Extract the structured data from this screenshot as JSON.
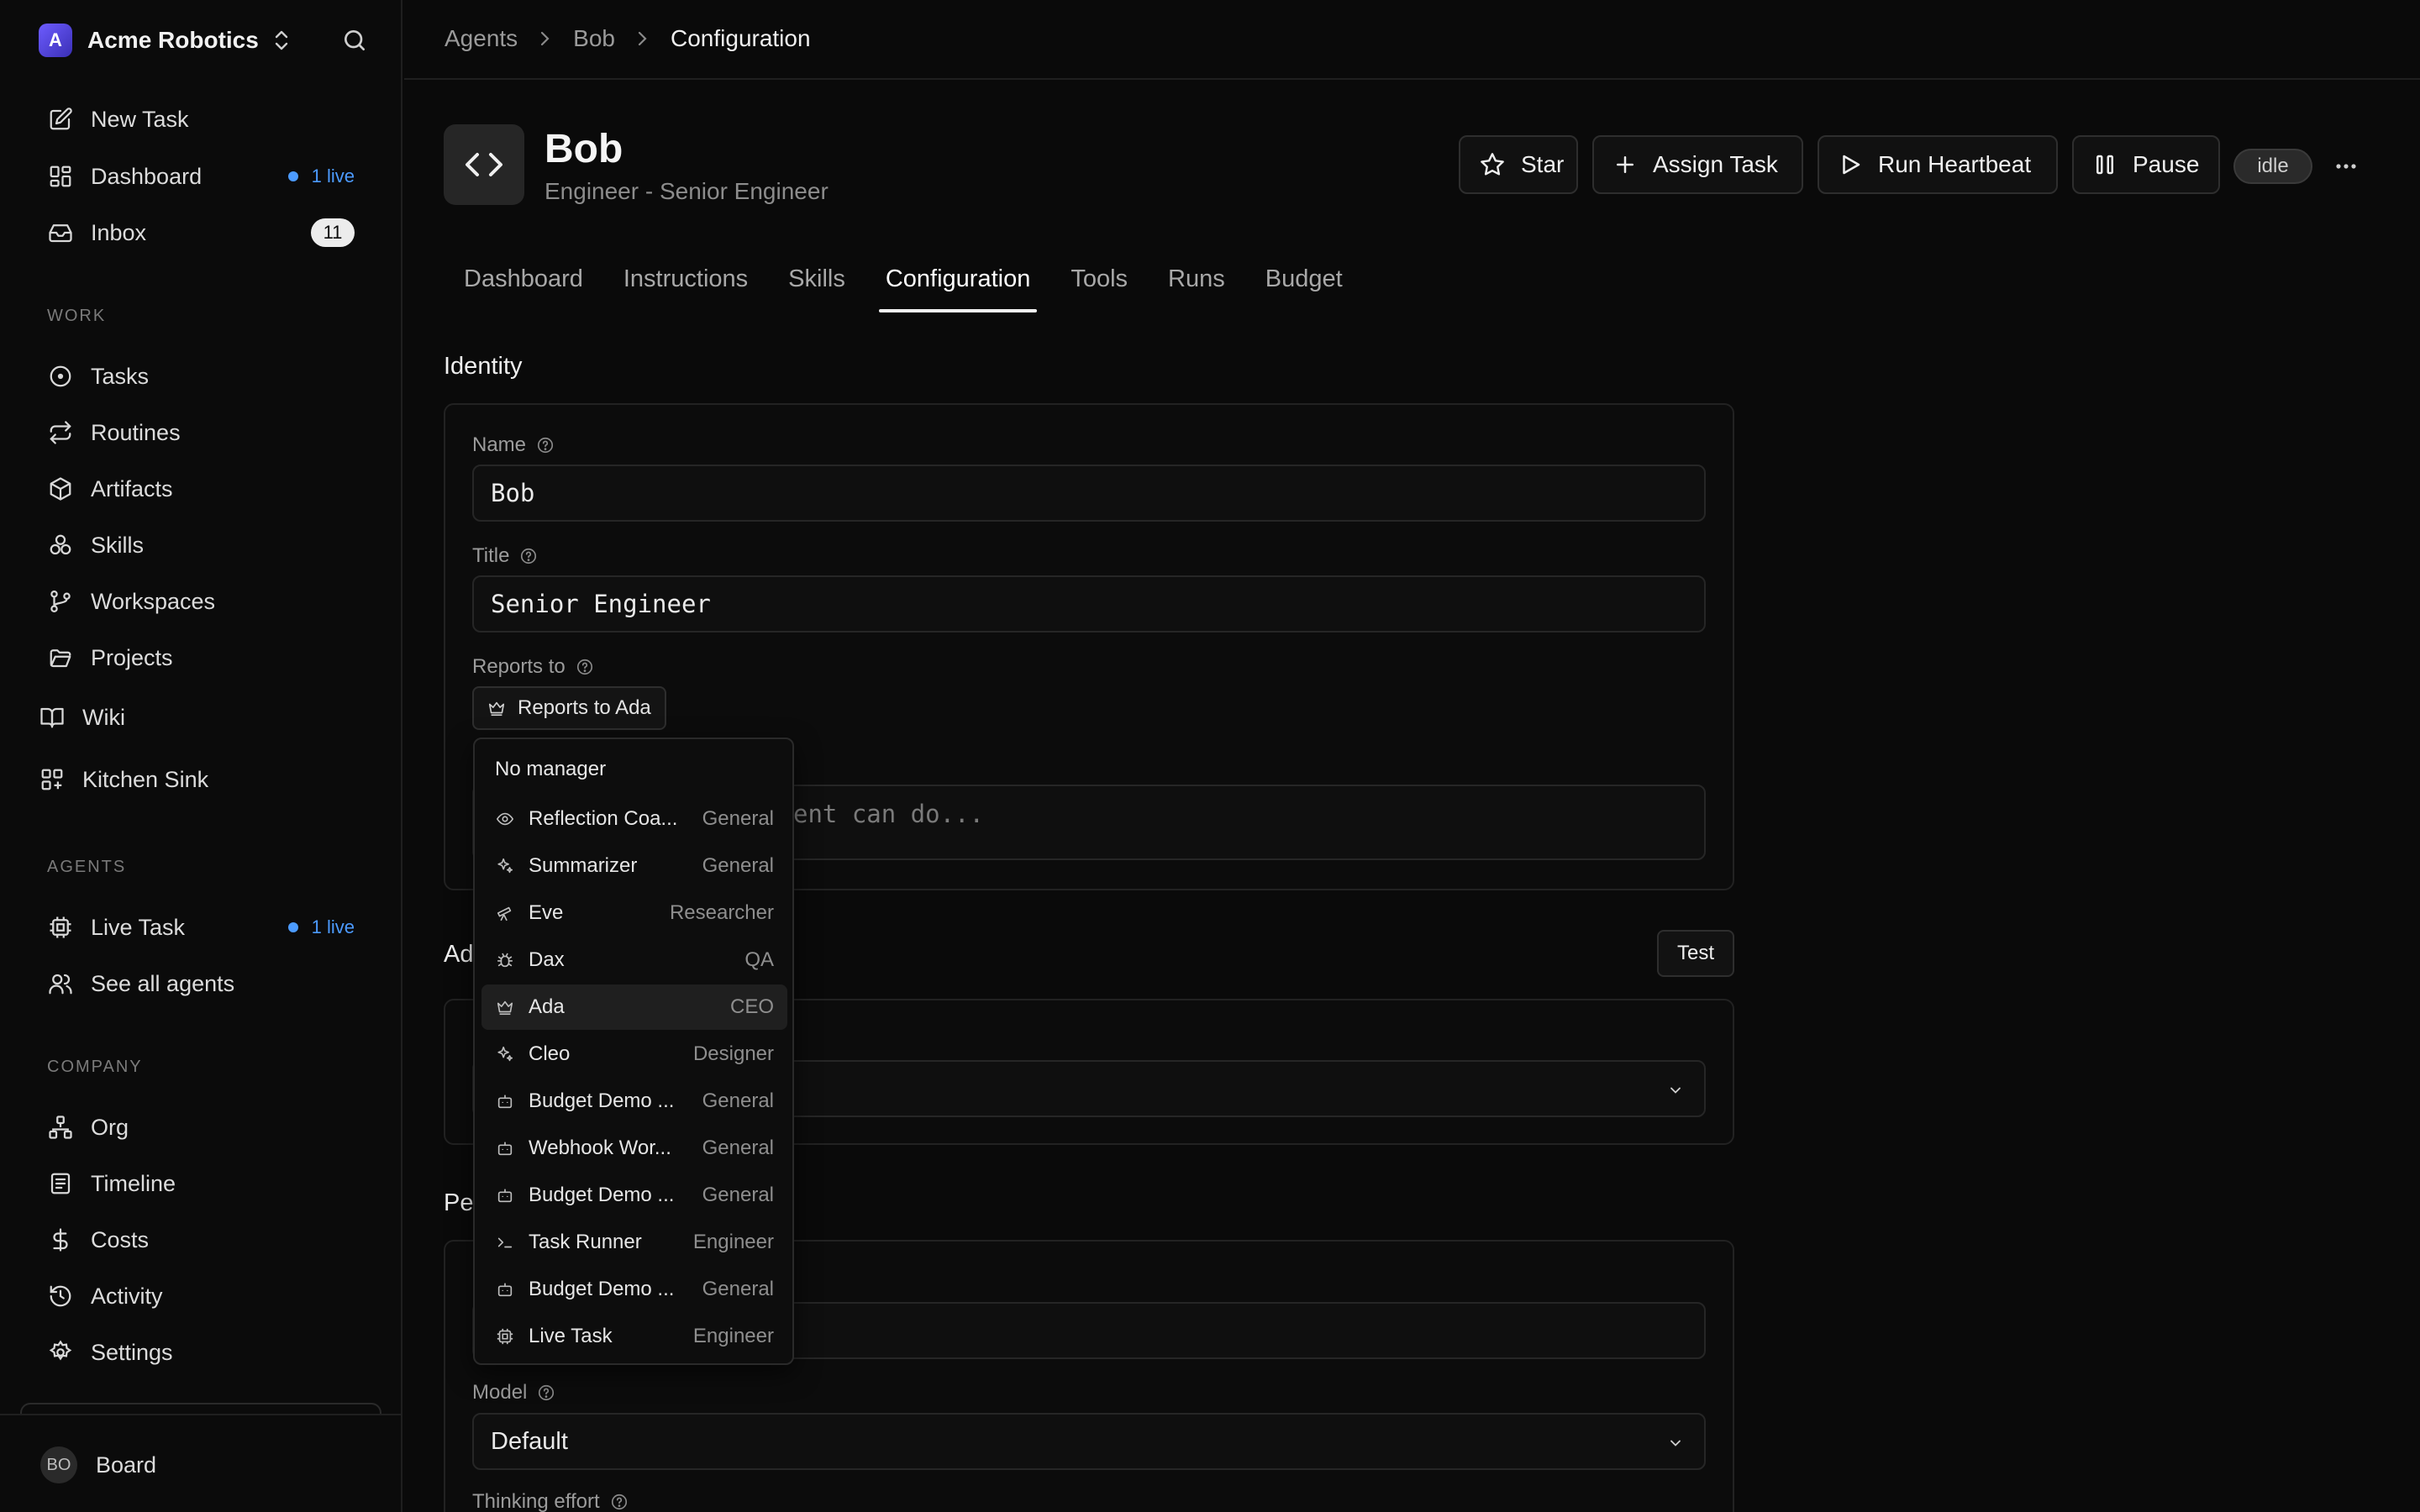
{
  "workspace": {
    "logo_letter": "A",
    "name": "Acme Robotics"
  },
  "sidebar": {
    "top_items": [
      {
        "label": "New Task"
      },
      {
        "label": "Dashboard",
        "live": "1 live"
      },
      {
        "label": "Inbox",
        "count": "11"
      }
    ],
    "sections": {
      "work": "WORK",
      "agents": "AGENTS",
      "company": "COMPANY"
    },
    "work_items": [
      {
        "label": "Tasks"
      },
      {
        "label": "Routines"
      },
      {
        "label": "Artifacts"
      },
      {
        "label": "Skills"
      },
      {
        "label": "Workspaces"
      },
      {
        "label": "Projects"
      },
      {
        "label": "Wiki"
      },
      {
        "label": "Kitchen Sink"
      }
    ],
    "agent_items": [
      {
        "label": "Live Task",
        "live": "1 live"
      },
      {
        "label": "See all agents"
      }
    ],
    "company_items": [
      {
        "label": "Org"
      },
      {
        "label": "Timeline"
      },
      {
        "label": "Costs"
      },
      {
        "label": "Activity"
      },
      {
        "label": "Settings"
      }
    ],
    "user": {
      "initials": "BO",
      "label": "Board"
    }
  },
  "breadcrumb": [
    "Agents",
    "Bob",
    "Configuration"
  ],
  "agent": {
    "name": "Bob",
    "subtitle": "Engineer - Senior Engineer",
    "status": "idle"
  },
  "actions": {
    "star": "Star",
    "assign": "Assign Task",
    "heartbeat": "Run Heartbeat",
    "pause": "Pause"
  },
  "tabs": [
    "Dashboard",
    "Instructions",
    "Skills",
    "Configuration",
    "Tools",
    "Runs",
    "Budget"
  ],
  "active_tab": "Configuration",
  "identity": {
    "title": "Identity",
    "name_label": "Name",
    "name_value": "Bob",
    "title_label": "Title",
    "title_value": "Senior Engineer",
    "reports_label": "Reports to",
    "reports_value": "Reports to Ada",
    "capabilities_placeholder_visible": "ent can do..."
  },
  "adapter": {
    "title_visible": "Ad",
    "test_label": "Test"
  },
  "permissions": {
    "title_visible": "Pe",
    "model_label": "Model",
    "model_value": "Default",
    "thinking_label": "Thinking effort"
  },
  "dropdown": {
    "none_label": "No manager",
    "items": [
      {
        "name": "Reflection Coa...",
        "role": "General",
        "icon": "eye-icon"
      },
      {
        "name": "Summarizer",
        "role": "General",
        "icon": "sparkle-icon"
      },
      {
        "name": "Eve",
        "role": "Researcher",
        "icon": "telescope-icon"
      },
      {
        "name": "Dax",
        "role": "QA",
        "icon": "bug-icon"
      },
      {
        "name": "Ada",
        "role": "CEO",
        "icon": "crown-icon",
        "highlighted": true
      },
      {
        "name": "Cleo",
        "role": "Designer",
        "icon": "sparkle-icon"
      },
      {
        "name": "Budget Demo ...",
        "role": "General",
        "icon": "bot-icon"
      },
      {
        "name": "Webhook Wor...",
        "role": "General",
        "icon": "bot-icon"
      },
      {
        "name": "Budget Demo ...",
        "role": "General",
        "icon": "bot-icon"
      },
      {
        "name": "Task Runner",
        "role": "Engineer",
        "icon": "terminal-icon"
      },
      {
        "name": "Budget Demo ...",
        "role": "General",
        "icon": "bot-icon"
      },
      {
        "name": "Live Task",
        "role": "Engineer",
        "icon": "cpu-icon"
      }
    ]
  },
  "colors": {
    "accent_live": "#4c9bff",
    "background": "#0a0a0a",
    "highlight": "#1f1f1f"
  }
}
